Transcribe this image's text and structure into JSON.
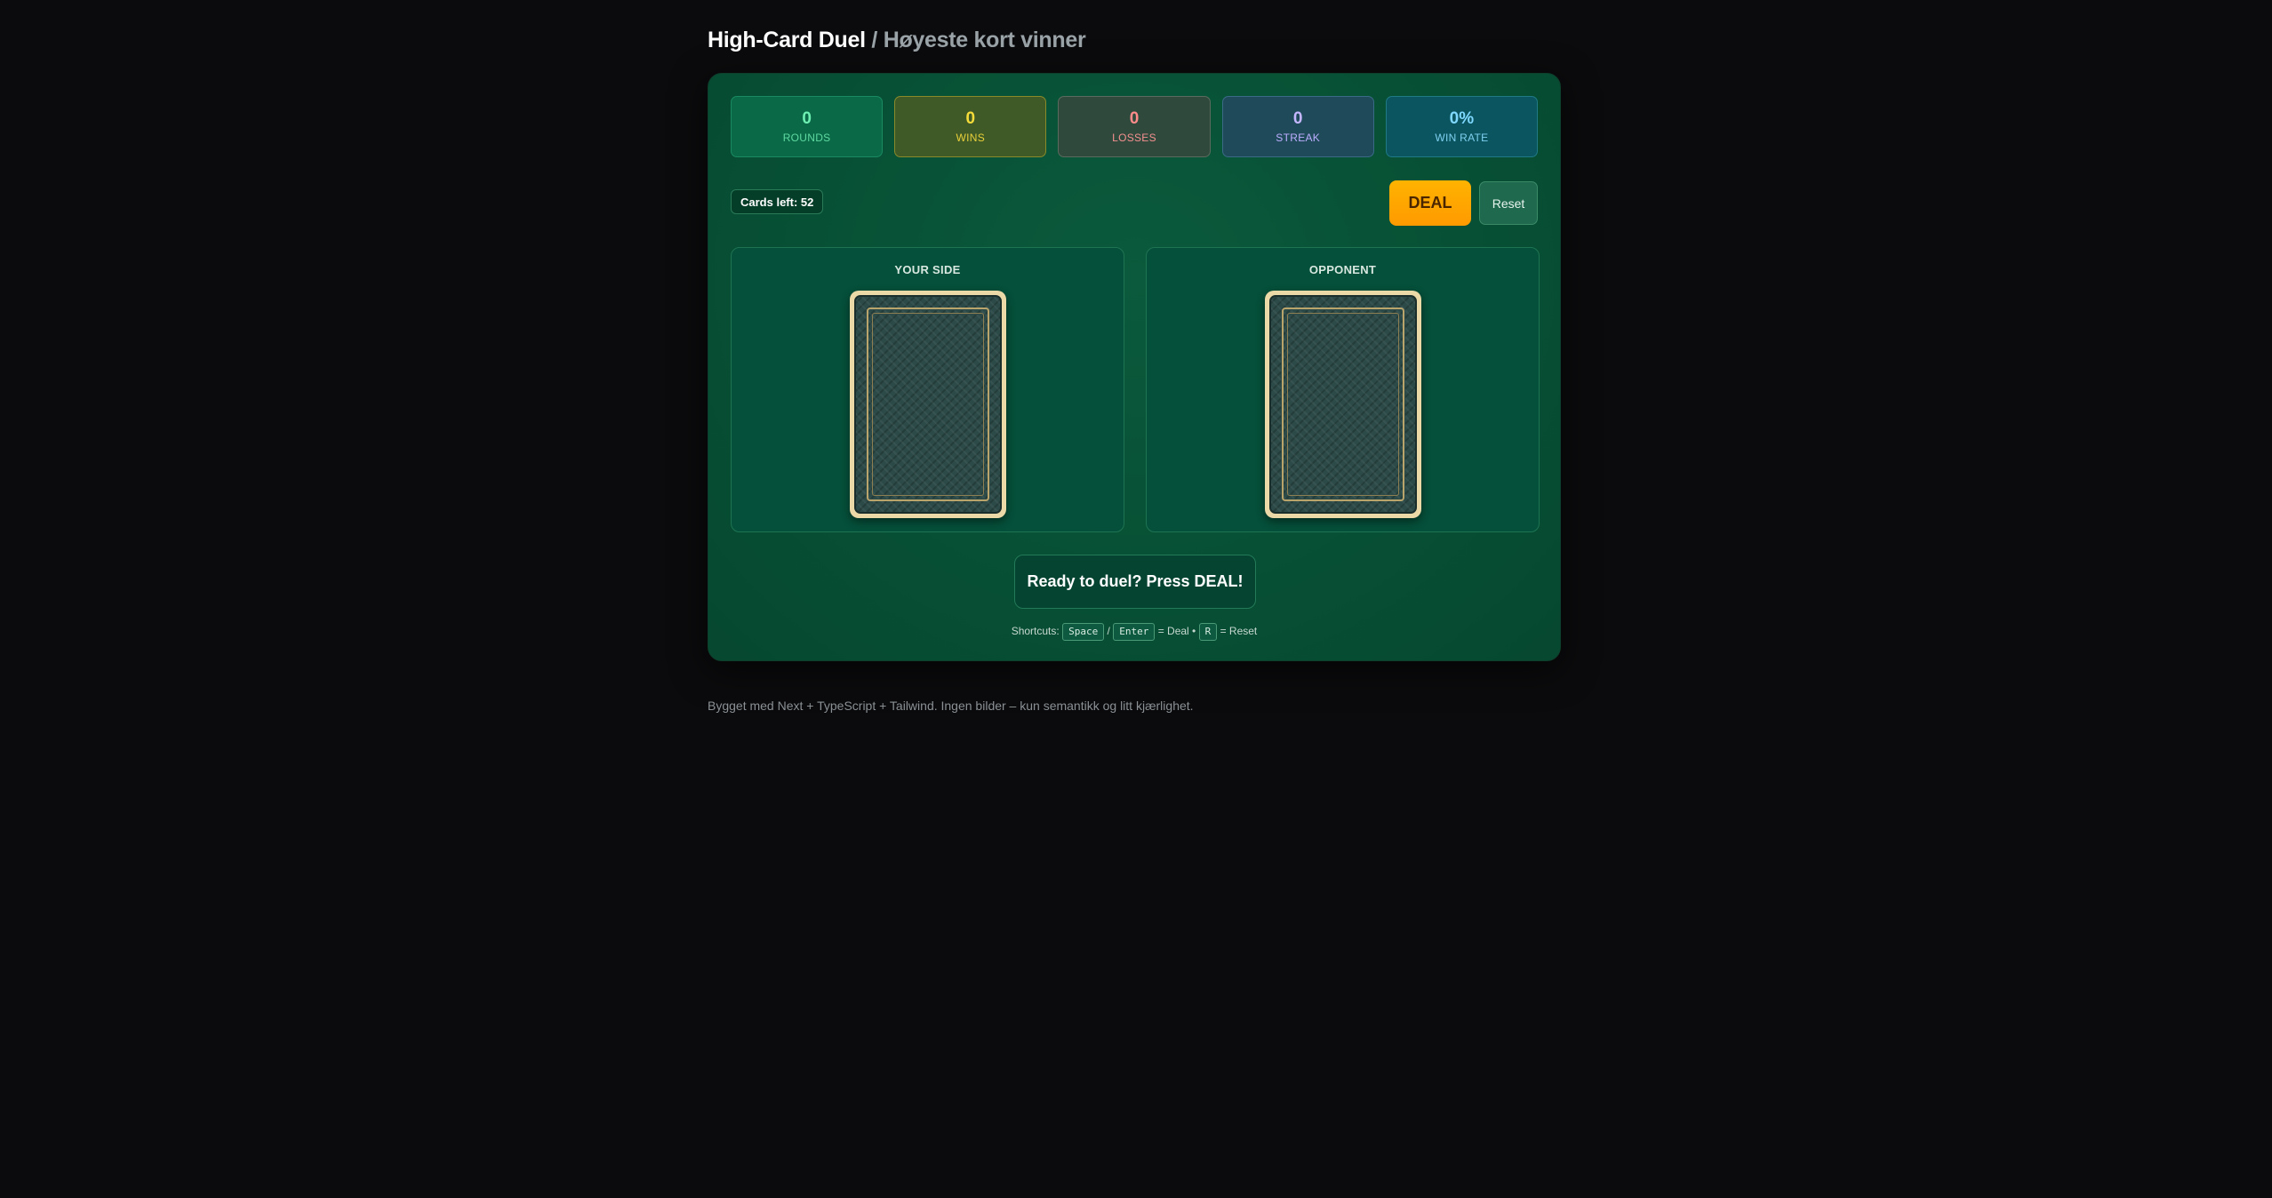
{
  "header": {
    "title_main": "High-Card Duel",
    "title_sub": "/ Høyeste kort vinner"
  },
  "stats": [
    {
      "value": "0",
      "label": "ROUNDS",
      "color": "#6ff0b3"
    },
    {
      "value": "0",
      "label": "WINS",
      "color": "#f5dc3a"
    },
    {
      "value": "0",
      "label": "LOSSES",
      "color": "#ff8b8b"
    },
    {
      "value": "0",
      "label": "STREAK",
      "color": "#c5b7ff"
    },
    {
      "value": "0%",
      "label": "WIN RATE",
      "color": "#7fd8ff"
    }
  ],
  "deck": {
    "cards_left_text": "Cards left: 52"
  },
  "controls": {
    "deal_label": "DEAL",
    "reset_label": "Reset",
    "deal_color": "#ffa800"
  },
  "sides": {
    "you_label": "YOUR SIDE",
    "opponent_label": "OPPONENT",
    "you_card": "card-back",
    "opponent_card": "card-back"
  },
  "status": {
    "message": "Ready to duel? Press DEAL!"
  },
  "shortcuts": {
    "prefix": "Shortcuts:",
    "key_space": "Space",
    "sep": "/",
    "key_enter": "Enter",
    "deal_text": "= Deal •",
    "key_r": "R",
    "reset_text": "= Reset"
  },
  "footer": {
    "text": "Bygget med Next + TypeScript + Tailwind. Ingen bilder – kun semantikk og litt kjærlighet."
  },
  "theme": {
    "felt_color": "#075035",
    "background": "#0b0b0d"
  }
}
